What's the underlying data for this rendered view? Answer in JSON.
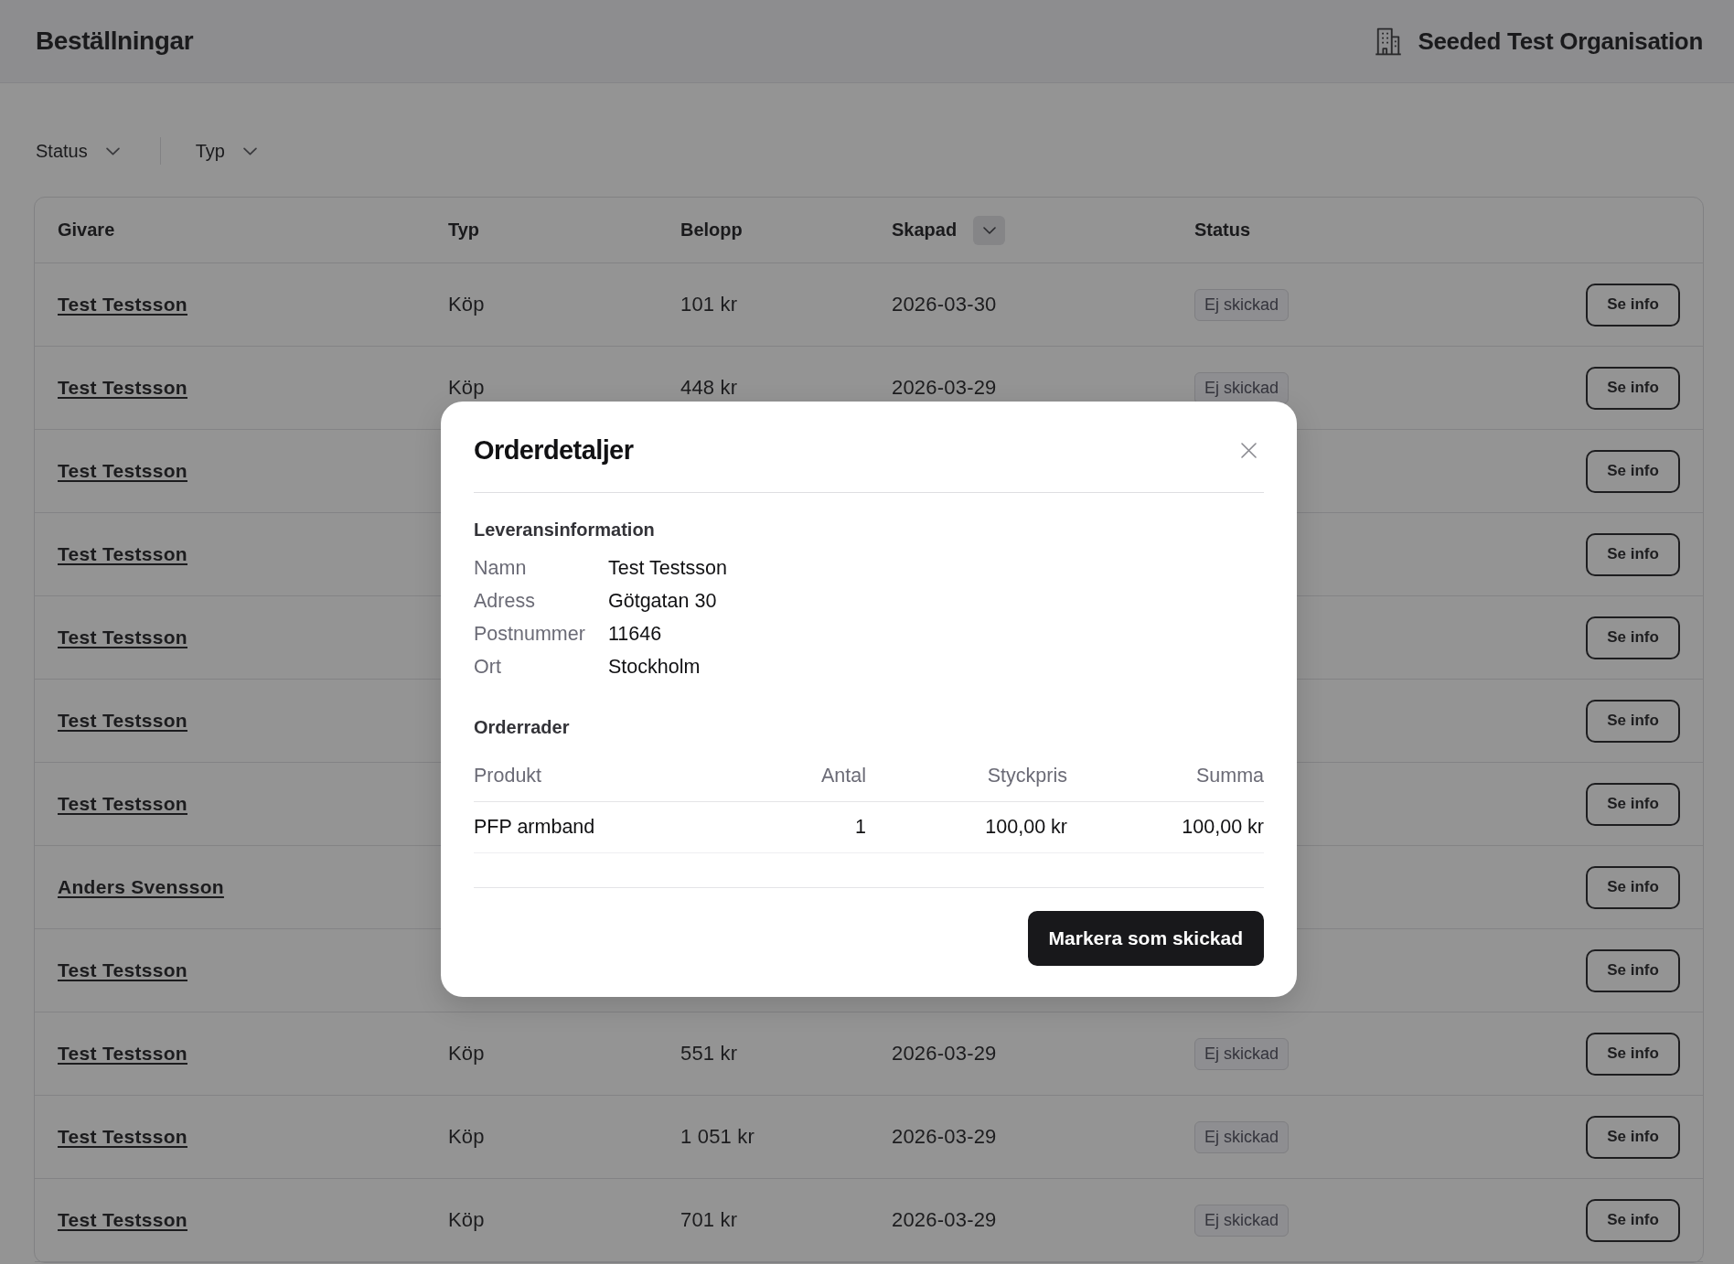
{
  "header": {
    "title": "Beställningar",
    "organisation": "Seeded Test Organisation"
  },
  "filters": [
    {
      "label": "Status"
    },
    {
      "label": "Typ"
    }
  ],
  "table": {
    "columns": [
      {
        "label": "Givare",
        "sortable": false
      },
      {
        "label": "Typ",
        "sortable": false
      },
      {
        "label": "Belopp",
        "sortable": false
      },
      {
        "label": "Skapad",
        "sortable": true
      },
      {
        "label": "Status",
        "sortable": false
      }
    ],
    "rows": [
      {
        "givare": "Test Testsson",
        "typ": "Köp",
        "belopp": "101 kr",
        "skapad": "2026-03-30",
        "status": "Ej skickad",
        "action": "Se info"
      },
      {
        "givare": "Test Testsson",
        "typ": "Köp",
        "belopp": "448 kr",
        "skapad": "2026-03-29",
        "status": "Ej skickad",
        "action": "Se info"
      },
      {
        "givare": "Test Testsson",
        "action": "Se info"
      },
      {
        "givare": "Test Testsson",
        "action": "Se info"
      },
      {
        "givare": "Test Testsson",
        "action": "Se info"
      },
      {
        "givare": "Test Testsson",
        "action": "Se info"
      },
      {
        "givare": "Test Testsson",
        "action": "Se info"
      },
      {
        "givare": "Anders Svensson",
        "action": "Se info"
      },
      {
        "givare": "Test Testsson",
        "action": "Se info"
      },
      {
        "givare": "Test Testsson",
        "typ": "Köp",
        "belopp": "551 kr",
        "skapad": "2026-03-29",
        "status": "Ej skickad",
        "action": "Se info"
      },
      {
        "givare": "Test Testsson",
        "typ": "Köp",
        "belopp": "1 051 kr",
        "skapad": "2026-03-29",
        "status": "Ej skickad",
        "action": "Se info"
      },
      {
        "givare": "Test Testsson",
        "typ": "Köp",
        "belopp": "701 kr",
        "skapad": "2026-03-29",
        "status": "Ej skickad",
        "action": "Se info"
      }
    ]
  },
  "dialog": {
    "title": "Orderdetaljer",
    "delivery": {
      "heading": "Leveransinformation",
      "fields": [
        {
          "label": "Namn",
          "value": "Test Testsson"
        },
        {
          "label": "Adress",
          "value": "Götgatan 30"
        },
        {
          "label": "Postnummer",
          "value": "11646"
        },
        {
          "label": "Ort",
          "value": "Stockholm"
        }
      ]
    },
    "order_lines": {
      "heading": "Orderrader",
      "columns": [
        "Produkt",
        "Antal",
        "Styckpris",
        "Summa"
      ],
      "rows": [
        [
          "PFP armband",
          "1",
          "100,00 kr",
          "100,00 kr"
        ]
      ]
    },
    "primary_button": "Markera som skickad"
  }
}
